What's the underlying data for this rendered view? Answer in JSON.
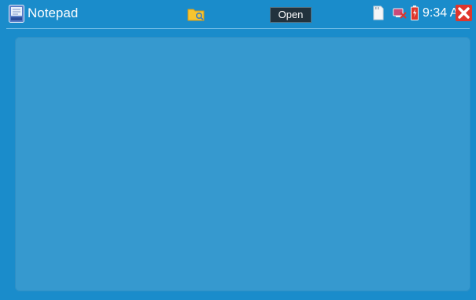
{
  "app": {
    "title": "Notepad",
    "icon": "notepad-app-icon"
  },
  "toolbar": {
    "folder_icon": "folder-search-icon",
    "open_label": "Open"
  },
  "status": {
    "sd_icon": "sd-card-icon",
    "network_icon": "network-disconnected-icon",
    "battery_icon": "battery-charging-icon",
    "time": "9:34 AM",
    "close_icon": "close-icon"
  },
  "editor": {
    "text": ""
  },
  "colors": {
    "background": "#1a8ccb",
    "editor": "#3699cf",
    "button": "#22323d",
    "close": "#e0362c"
  }
}
